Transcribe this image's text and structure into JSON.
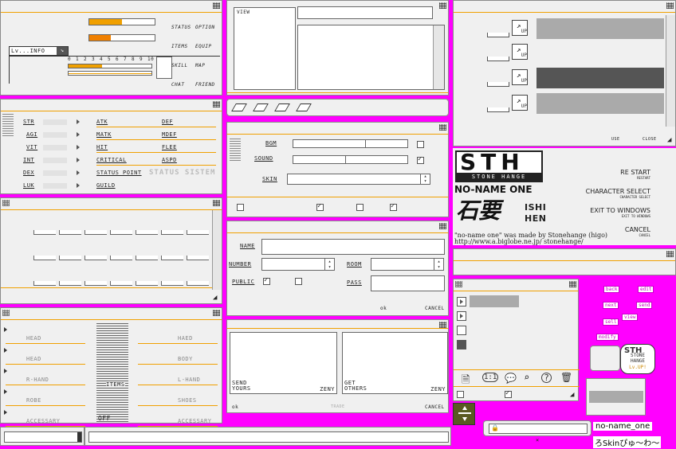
{
  "top_left": {
    "info_tab": "Lv...INFO",
    "scale": [
      "0",
      "1",
      "2",
      "3",
      "4",
      "5",
      "6",
      "7",
      "8",
      "9",
      "10"
    ],
    "menu": [
      "STATUS",
      "OPTION",
      "ITEMS",
      "EQUIP",
      "SKILL",
      "MAP",
      "CHAT",
      "FRIEND"
    ],
    "bar1_fill": 0.5,
    "bar2_fill": 0.33
  },
  "status": {
    "left": [
      "STR",
      "AGI",
      "VIT",
      "INT",
      "DEX",
      "LUK"
    ],
    "mid": [
      "ATK",
      "MATK",
      "HIT",
      "CRITICAL",
      "STATUS POINT",
      "GUILD"
    ],
    "right": [
      "DEF",
      "MDEF",
      "FLEE",
      "ASPD"
    ],
    "logo": "STATUS SISTEM"
  },
  "equip": {
    "left": [
      "HEAD",
      "HEAD",
      "R-HAND",
      "ROBE",
      "ACCESSARY"
    ],
    "right": [
      "HAED",
      "BODY",
      "L-HAND",
      "SHOES",
      "ACCESSARY"
    ],
    "center": "ITEMS",
    "off": "OFF"
  },
  "view": {
    "label": "VIEW"
  },
  "option": {
    "bgm": "BGM",
    "sound": "SOUND",
    "skin": "SKIN"
  },
  "room": {
    "name": "NAME",
    "number": "NUMBER",
    "room": "ROOM",
    "public": "PUBLIC",
    "pass": "PASS",
    "ok": "ok",
    "cancel": "CANCEL"
  },
  "trade": {
    "send": "SEND\nYOURS",
    "zeny1": "ZENY",
    "get": "GET\nOTHERS",
    "zeny2": "ZENY",
    "ok": "ok",
    "trade": "TRADE",
    "cancel": "CANCEL"
  },
  "skills": {
    "up": "UP",
    "use": "USE",
    "close": "CLOSE"
  },
  "title": {
    "logo": "STH",
    "logo_sub": "STONE HANGE",
    "noname": "NO-NAME ONE",
    "ishi": "ISHI",
    "hen": "HEN",
    "credit": "\"no-name one\" was made by Stonehange (higo)",
    "url": "http://www.a.biglobe.ne.jp/ stonehange/",
    "menu": [
      {
        "main": "RE START",
        "sub": "RESTART"
      },
      {
        "main": "CHARACTER SELECT",
        "sub": "CHARACTER SELECT"
      },
      {
        "main": "EXIT TO WINDOWS",
        "sub": "EXIT TO WINDOWS"
      },
      {
        "main": "CANCEL",
        "sub": "CANCEL"
      }
    ]
  },
  "pink_buttons": [
    "back",
    "edit",
    "next",
    "send",
    "sell",
    "view",
    "modify"
  ],
  "stamp": {
    "line1": "STONE",
    "line2": "HANGE",
    "line3": "Lv.UP!"
  },
  "bottom": {
    "name": "no-name_one",
    "skin": "ろSkinぴゅ〜わ〜"
  },
  "colors": {
    "accent": "#f0a000",
    "magenta": "#ff00ff",
    "panel": "#f0f0f0"
  }
}
